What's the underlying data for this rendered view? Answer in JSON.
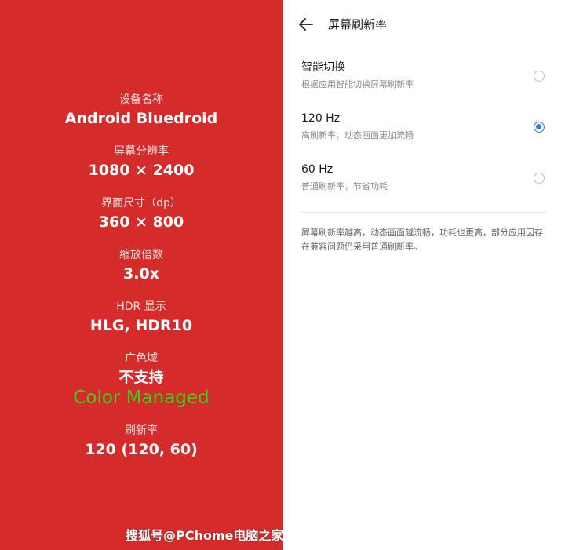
{
  "device_info": {
    "device_name_label": "设备名称",
    "device_name_value": "Android Bluedroid",
    "resolution_label": "屏幕分辨率",
    "resolution_value": "1080 × 2400",
    "ui_size_label": "界面尺寸（dp）",
    "ui_size_value": "360 × 800",
    "scale_label": "缩放倍数",
    "scale_value": "3.0x",
    "hdr_label": "HDR 显示",
    "hdr_value": "HLG, HDR10",
    "gamut_label": "广色域",
    "gamut_value": "不支持",
    "gamut_extra": "Color Managed",
    "refresh_label": "刷新率",
    "refresh_value": "120 (120, 60)"
  },
  "settings": {
    "title": "屏幕刷新率",
    "options": [
      {
        "title": "智能切换",
        "desc": "根据应用智能切换屏幕刷新率",
        "selected": false
      },
      {
        "title": "120 Hz",
        "desc": "高刷新率，动态画面更加流畅",
        "selected": true
      },
      {
        "title": "60 Hz",
        "desc": "普通刷新率，节省功耗",
        "selected": false
      }
    ],
    "note": "屏幕刷新率越高，动态画面越流畅，功耗也更高，部分应用因存在兼容问题仍采用普通刷新率。"
  },
  "watermark": "搜狐号@PChome电脑之家",
  "colors": {
    "left_background": "#d62b2b",
    "accent_blue": "#2f7de1",
    "color_managed_green": "#3bd11f"
  },
  "icons": {
    "back": "arrow-left-icon"
  }
}
